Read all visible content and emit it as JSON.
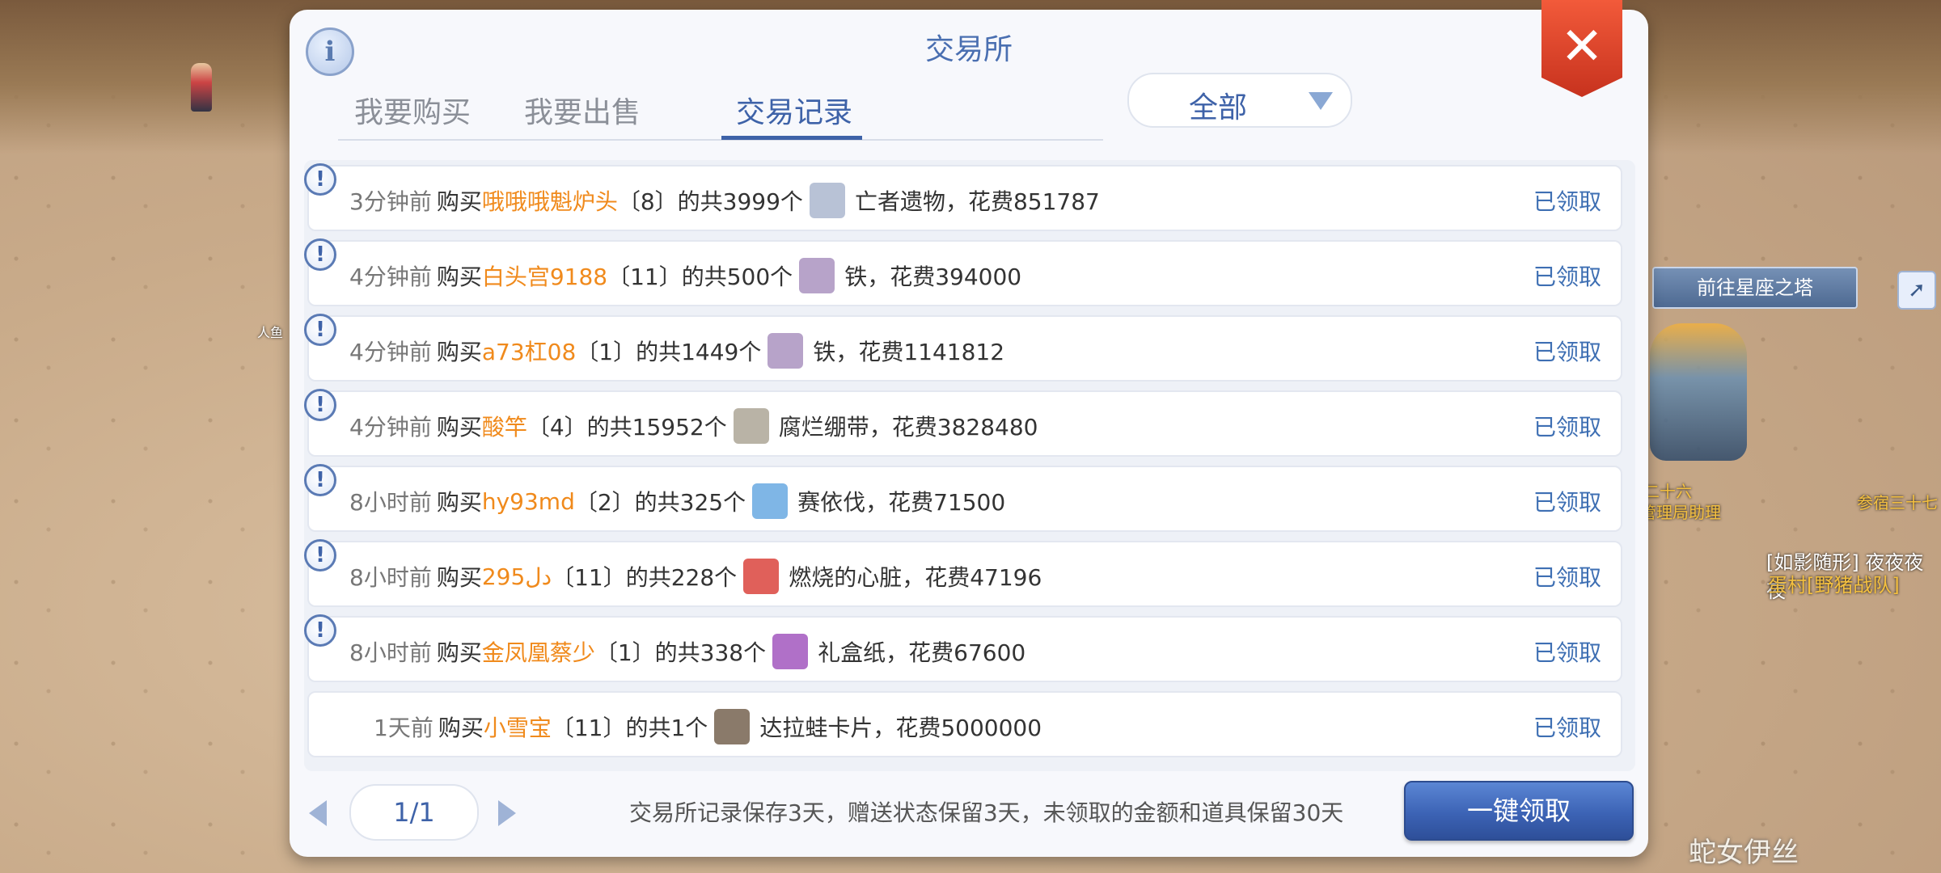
{
  "panel": {
    "title": "交易所",
    "info_icon": "info-icon",
    "close_icon": "close-icon",
    "close_symbol": "✕"
  },
  "tabs": [
    {
      "label": "我要购买",
      "active": false
    },
    {
      "label": "我要出售",
      "active": false
    },
    {
      "label": "交易记录",
      "active": true
    }
  ],
  "filter": {
    "selected": "全部"
  },
  "records": [
    {
      "time": "3分钟前",
      "action": "购买",
      "seller": "哦哦哦魁炉头",
      "mid": "〔8〕的共3999个",
      "item": "亡者遗物，花费851787",
      "status": "已领取",
      "icon": "relic-box-icon",
      "icon_color": "#b8c2d6"
    },
    {
      "time": "4分钟前",
      "action": "购买",
      "seller": "白头宫9188",
      "mid": "〔11〕的共500个",
      "item": "铁，花费394000",
      "status": "已领取",
      "icon": "iron-ore-icon",
      "icon_color": "#b7a3c9"
    },
    {
      "time": "4分钟前",
      "action": "购买",
      "seller": "a73杠08",
      "mid": "〔1〕的共1449个",
      "item": "铁，花费1141812",
      "status": "已领取",
      "icon": "iron-ore-icon",
      "icon_color": "#b7a3c9"
    },
    {
      "time": "4分钟前",
      "action": "购买",
      "seller": "酸竿",
      "mid": "〔4〕的共15952个",
      "item": "腐烂绷带，花费3828480",
      "status": "已领取",
      "icon": "bandage-icon",
      "icon_color": "#b9b3a6"
    },
    {
      "time": "8小时前",
      "action": "购买",
      "seller": "hy93md",
      "mid": "〔2〕的共325个",
      "item": "赛依伐，花费71500",
      "status": "已领取",
      "icon": "crystal-icon",
      "icon_color": "#7fb6e6"
    },
    {
      "time": "8小时前",
      "action": "购买",
      "seller": "دل295",
      "mid": "〔11〕的共228个",
      "item": "燃烧的心脏，花费47196",
      "status": "已领取",
      "icon": "burning-heart-icon",
      "icon_color": "#e0605a"
    },
    {
      "time": "8小时前",
      "action": "购买",
      "seller": "金凤凰蔡少",
      "mid": "〔1〕的共338个",
      "item": "礼盒纸，花费67600",
      "status": "已领取",
      "icon": "gift-paper-icon",
      "icon_color": "#b070c8"
    },
    {
      "time": "1天前",
      "action": "购买",
      "seller": "小雪宝",
      "mid": "〔11〕的共1个",
      "item": "达拉蛙卡片，花费5000000",
      "status": "已领取",
      "icon": "card-icon",
      "icon_color": "#8a7a6a"
    }
  ],
  "pagination": {
    "page": "1/1"
  },
  "notice": "交易所记录保存3天，赠送状态保留3天，未领取的金额和道具保留30天",
  "claim_all": "一键领取",
  "background": {
    "tower_button": "前往星座之塔",
    "label_left": "人鱼",
    "label_mid1": "二十六",
    "label_mid2": "管理局助理",
    "label_right": "参宿三十七",
    "guild_line1": "[如影随形] 夜夜夜夜",
    "guild_line2": "蛋村[野猪战队]",
    "watermark": "蛇女伊丝"
  }
}
